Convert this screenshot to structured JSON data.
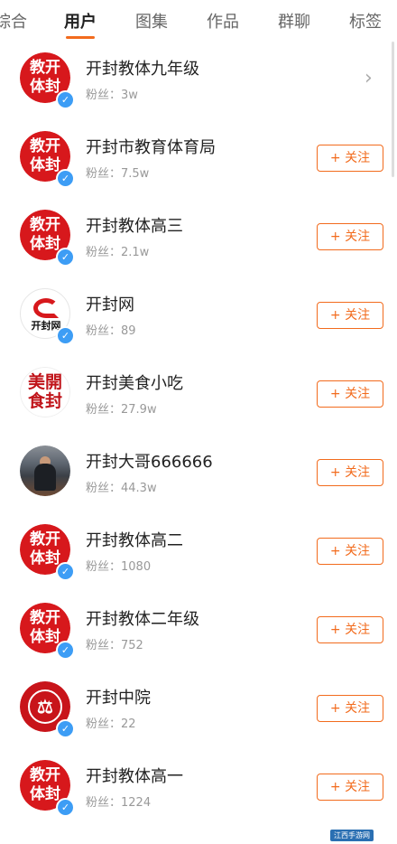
{
  "tabs": [
    {
      "label": "综合",
      "active": false
    },
    {
      "label": "用户",
      "active": true
    },
    {
      "label": "图集",
      "active": false
    },
    {
      "label": "作品",
      "active": false
    },
    {
      "label": "群聊",
      "active": false
    },
    {
      "label": "标签",
      "active": false
    }
  ],
  "colors": {
    "accent": "#f26b1d",
    "verified": "#3d9df5",
    "avatar_red": "#d7181c"
  },
  "users": [
    {
      "name": "开封教体九年级",
      "fans": "粉丝：3w",
      "action": "chevron-right",
      "avatar_text": "教开体封",
      "verified": true
    },
    {
      "name": "开封市教育体育局",
      "fans": "粉丝：7.5w",
      "action": "+ 关注",
      "avatar_text": "教开体封",
      "verified": true
    },
    {
      "name": "开封教体高三",
      "fans": "粉丝：2.1w",
      "action": "+ 关注",
      "avatar_text": "教开体封",
      "verified": true
    },
    {
      "name": "开封网",
      "fans": "粉丝：89",
      "action": "+ 关注",
      "avatar_text": "开封网",
      "verified": true
    },
    {
      "name": "开封美食小吃",
      "fans": "粉丝：27.9w",
      "action": "+ 关注",
      "avatar_text": "美開食封",
      "verified": false
    },
    {
      "name": "开封大哥666666",
      "fans": "粉丝：44.3w",
      "action": "+ 关注",
      "avatar_text": "",
      "verified": false
    },
    {
      "name": "开封教体高二",
      "fans": "粉丝：1080",
      "action": "+ 关注",
      "avatar_text": "教开体封",
      "verified": true
    },
    {
      "name": "开封教体二年级",
      "fans": "粉丝：752",
      "action": "+ 关注",
      "avatar_text": "教开体封",
      "verified": true
    },
    {
      "name": "开封中院",
      "fans": "粉丝：22",
      "action": "+ 关注",
      "avatar_text": "",
      "verified": true
    },
    {
      "name": "开封教体高一",
      "fans": "粉丝：1224",
      "action": "+ 关注",
      "avatar_text": "教开体封",
      "verified": true
    }
  ],
  "icons": {
    "verified": "checkmark-badge-icon",
    "more": "chevron-right-icon"
  },
  "watermark": "江西手游网"
}
